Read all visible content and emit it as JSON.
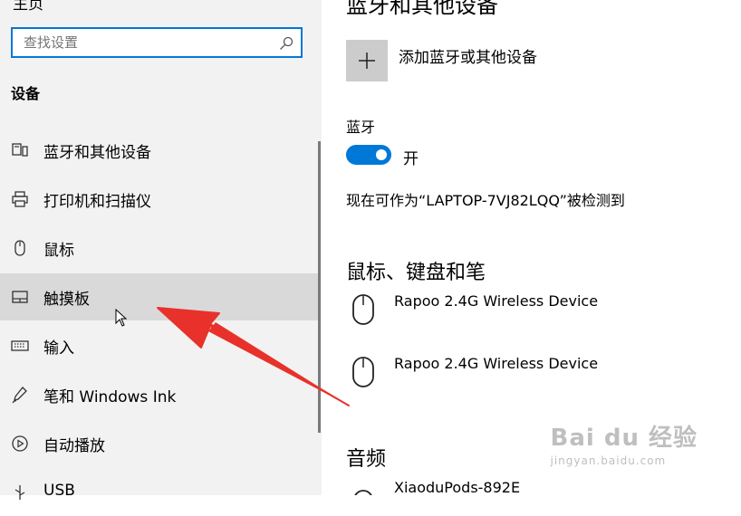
{
  "sidebar": {
    "home_fragment": "主页",
    "search": {
      "placeholder": "查找设置"
    },
    "section_title": "设备",
    "items": [
      {
        "label": "蓝牙和其他设备",
        "icon": "bluetooth-devices-icon"
      },
      {
        "label": "打印机和扫描仪",
        "icon": "printer-icon"
      },
      {
        "label": "鼠标",
        "icon": "mouse-icon"
      },
      {
        "label": "触摸板",
        "icon": "touchpad-icon",
        "selected": true
      },
      {
        "label": "输入",
        "icon": "keyboard-icon"
      },
      {
        "label": "笔和 Windows Ink",
        "icon": "pen-icon"
      },
      {
        "label": "自动播放",
        "icon": "autoplay-icon"
      },
      {
        "label": "USB",
        "icon": "usb-icon"
      }
    ]
  },
  "main": {
    "title_fragment": "蓝牙和其他设备",
    "add_device_label": "添加蓝牙或其他设备",
    "bluetooth": {
      "label": "蓝牙",
      "state": "开",
      "on": true,
      "discoverable_text": "现在可作为“LAPTOP-7VJ82LQQ”被检测到"
    },
    "mouse_section": {
      "heading": "鼠标、键盘和笔",
      "devices": [
        "Rapoo 2.4G Wireless Device",
        "Rapoo 2.4G Wireless Device"
      ]
    },
    "audio_section": {
      "heading": "音频",
      "devices": [
        "XiaoduPods-892E"
      ]
    }
  },
  "colors": {
    "accent": "#0078d7",
    "sidebar_bg": "#f2f2f2",
    "selected_bg": "#d9d9d9",
    "arrow": "#e8312a"
  },
  "watermark": {
    "main": "Bai du 经验",
    "sub": "jingyan.baidu.com"
  }
}
